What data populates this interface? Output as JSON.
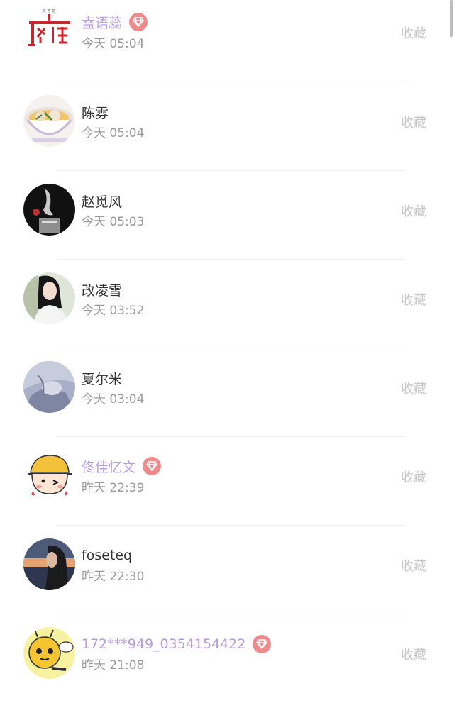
{
  "contacts": [
    {
      "name": "盍语蕊",
      "time": "今天 05:04",
      "vip": true,
      "action": "收藏",
      "avatar": "logo-gudu-avatar",
      "avatar_text": "孤独"
    },
    {
      "name": "陈雰",
      "time": "今天 05:04",
      "vip": false,
      "action": "收藏",
      "avatar": "soup-bowl-avatar"
    },
    {
      "name": "赵觅风",
      "time": "今天 05:03",
      "vip": false,
      "action": "收藏",
      "avatar": "dark-photo-avatar"
    },
    {
      "name": "改凌雪",
      "time": "今天 03:52",
      "vip": false,
      "action": "收藏",
      "avatar": "girl-photo-avatar"
    },
    {
      "name": "夏尔米",
      "time": "今天 03:04",
      "vip": false,
      "action": "收藏",
      "avatar": "anime-photo-avatar"
    },
    {
      "name": "佟佳忆文",
      "time": "昨天 22:39",
      "vip": true,
      "action": "收藏",
      "avatar": "cartoon-child-avatar"
    },
    {
      "name": "foseteq",
      "time": "昨天 22:30",
      "vip": false,
      "action": "收藏",
      "avatar": "sunset-portrait-avatar"
    },
    {
      "name": "172***949_0354154422",
      "time": "昨天 21:08",
      "vip": true,
      "action": "收藏",
      "avatar": "cartoon-bee-avatar"
    }
  ],
  "colors": {
    "vip_name": "#b89ae0",
    "vip_badge": "#f08a8a",
    "time": "#9b9b9b",
    "action": "#c8c8c8"
  }
}
